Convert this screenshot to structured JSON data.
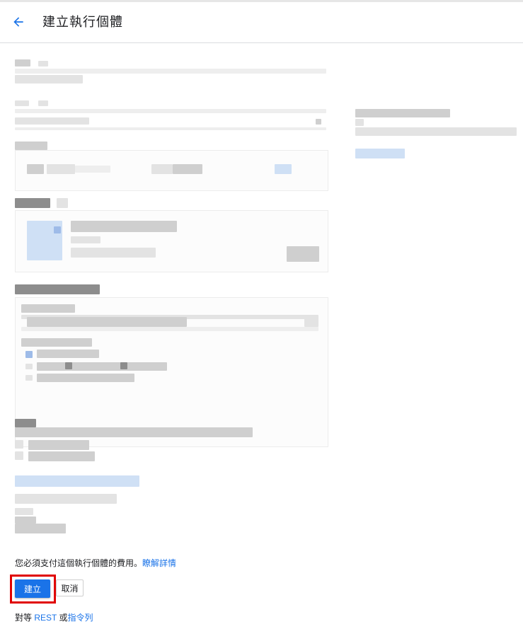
{
  "header": {
    "back_icon": "arrow-back-icon",
    "title": "建立執行個體"
  },
  "footer": {
    "fee_text": "您必須支付這個執行個體的費用。",
    "fee_link": "瞭解詳情",
    "create_label": "建立",
    "cancel_label": "取消",
    "equiv_prefix": "對等 ",
    "rest_link": "REST",
    "equiv_or": " 或",
    "cli_link": "指令列"
  },
  "colors": {
    "accent": "#1a73e8",
    "highlight": "#e00000"
  }
}
